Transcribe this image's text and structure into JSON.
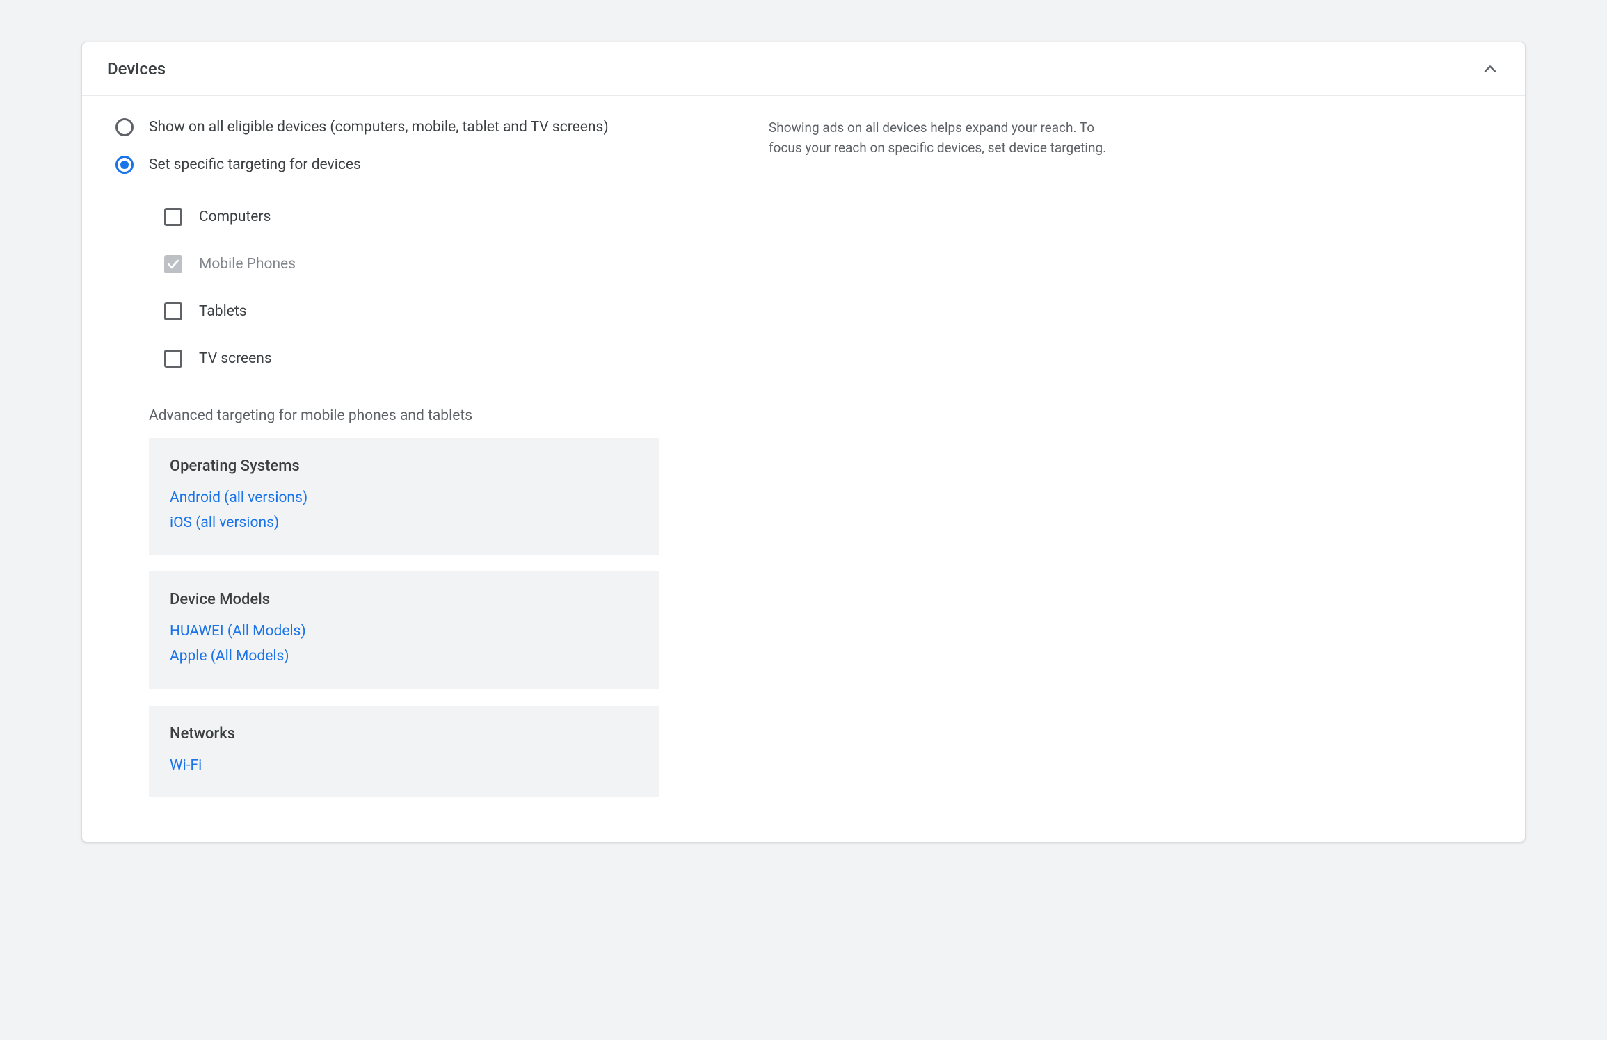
{
  "header": {
    "title": "Devices"
  },
  "radioOptions": {
    "all": "Show on all eligible devices (computers, mobile, tablet and TV screens)",
    "specific": "Set specific targeting for devices"
  },
  "checkboxes": {
    "computers": "Computers",
    "mobile": "Mobile Phones",
    "tablets": "Tablets",
    "tv": "TV screens"
  },
  "advancedLabel": "Advanced targeting for mobile phones and tablets",
  "os": {
    "title": "Operating Systems",
    "items": [
      "Android (all versions)",
      "iOS (all versions)"
    ]
  },
  "models": {
    "title": "Device Models",
    "items": [
      "HUAWEI (All Models)",
      "Apple (All Models)"
    ]
  },
  "networks": {
    "title": "Networks",
    "items": [
      "Wi-Fi"
    ]
  },
  "helpText": "Showing ads on all devices helps expand your reach. To focus your reach on specific devices, set device targeting."
}
